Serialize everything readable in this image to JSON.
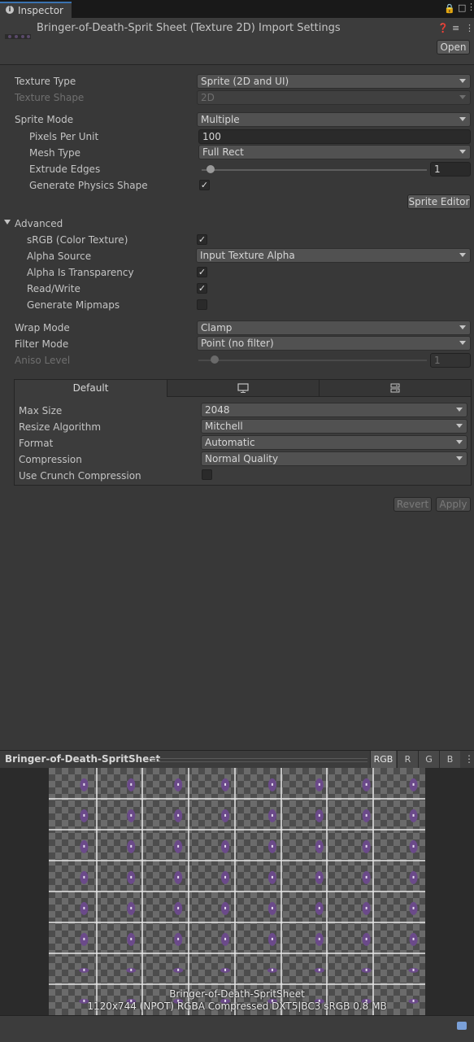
{
  "tab": {
    "label": "Inspector",
    "icon": "info-icon"
  },
  "header": {
    "title": "Bringer-of-Death-Sprit Sheet (Texture 2D) Import Settings",
    "open_label": "Open"
  },
  "fields": {
    "texture_type": {
      "label": "Texture Type",
      "value": "Sprite (2D and UI)"
    },
    "texture_shape": {
      "label": "Texture Shape",
      "value": "2D"
    },
    "sprite_mode": {
      "label": "Sprite Mode",
      "value": "Multiple"
    },
    "pixels_per_unit": {
      "label": "Pixels Per Unit",
      "value": "100"
    },
    "mesh_type": {
      "label": "Mesh Type",
      "value": "Full Rect"
    },
    "extrude_edges": {
      "label": "Extrude Edges",
      "value": "1"
    },
    "generate_physics_shape": {
      "label": "Generate Physics Shape",
      "checked": true
    },
    "sprite_editor_label": "Sprite Editor"
  },
  "advanced": {
    "label": "Advanced",
    "srgb": {
      "label": "sRGB (Color Texture)",
      "checked": true
    },
    "alpha_source": {
      "label": "Alpha Source",
      "value": "Input Texture Alpha"
    },
    "alpha_is_transparency": {
      "label": "Alpha Is Transparency",
      "checked": true
    },
    "read_write": {
      "label": "Read/Write",
      "checked": true
    },
    "generate_mipmaps": {
      "label": "Generate Mipmaps",
      "checked": false
    }
  },
  "wrap": {
    "wrap_mode": {
      "label": "Wrap Mode",
      "value": "Clamp"
    },
    "filter_mode": {
      "label": "Filter Mode",
      "value": "Point (no filter)"
    },
    "aniso_level": {
      "label": "Aniso Level",
      "value": "1"
    }
  },
  "platform": {
    "tabs": [
      {
        "label": "Default",
        "icon": ""
      },
      {
        "label": "",
        "icon": "monitor-icon"
      },
      {
        "label": "",
        "icon": "server-icon"
      }
    ],
    "max_size": {
      "label": "Max Size",
      "value": "2048"
    },
    "resize_algorithm": {
      "label": "Resize Algorithm",
      "value": "Mitchell"
    },
    "format": {
      "label": "Format",
      "value": "Automatic"
    },
    "compression": {
      "label": "Compression",
      "value": "Normal Quality"
    },
    "use_crunch": {
      "label": "Use Crunch Compression",
      "checked": false
    }
  },
  "actions": {
    "revert_label": "Revert",
    "apply_label": "Apply"
  },
  "preview": {
    "title": "Bringer-of-Death-SpritSheet",
    "channels": [
      "RGB",
      "R",
      "G",
      "B"
    ],
    "info_name": "Bringer-of-Death-SpritSheet",
    "info_details": "1120x744 (NPOT)  RGBA Compressed DXT5|BC3 sRGB  0.8 MB"
  },
  "colors": {
    "accent": "#3a72b0",
    "background": "#383838",
    "sprite_purple": "#6b4a8a"
  }
}
